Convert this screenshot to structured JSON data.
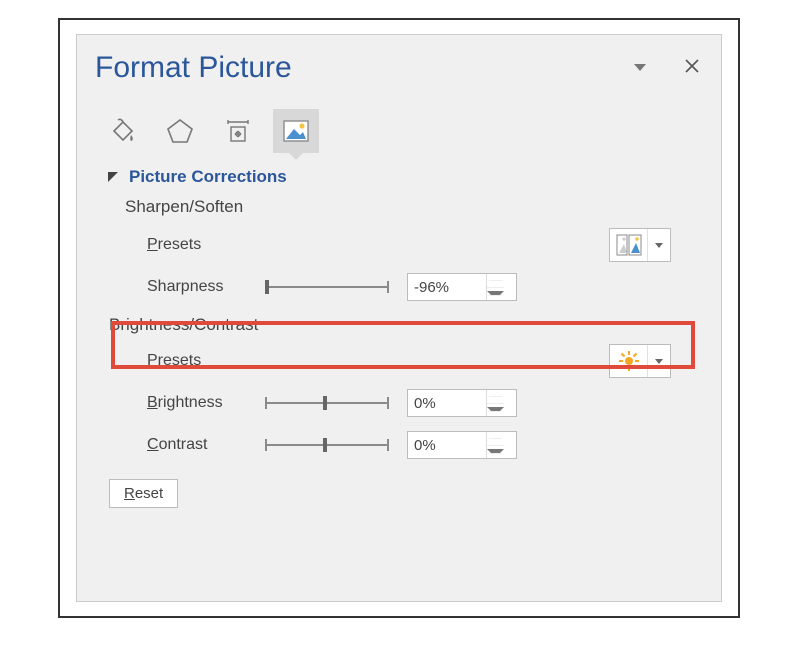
{
  "pane": {
    "title": "Format Picture"
  },
  "tabs": {
    "fill": "fill-line-icon",
    "effects": "effects-icon",
    "size": "size-props-icon",
    "picture": "picture-icon"
  },
  "corrections": {
    "title": "Picture Corrections",
    "sharpen_soften_label": "Sharpen/Soften",
    "presets_label": "Presets",
    "sharpness_label": "Sharpness",
    "sharpness_value": "-96%",
    "brightness_contrast_label": "Brightness/Contrast",
    "presets2_label": "Presets",
    "brightness_label": "Brightness",
    "brightness_value": "0%",
    "contrast_label": "Contrast",
    "contrast_value": "0%",
    "reset_label": "Reset"
  }
}
